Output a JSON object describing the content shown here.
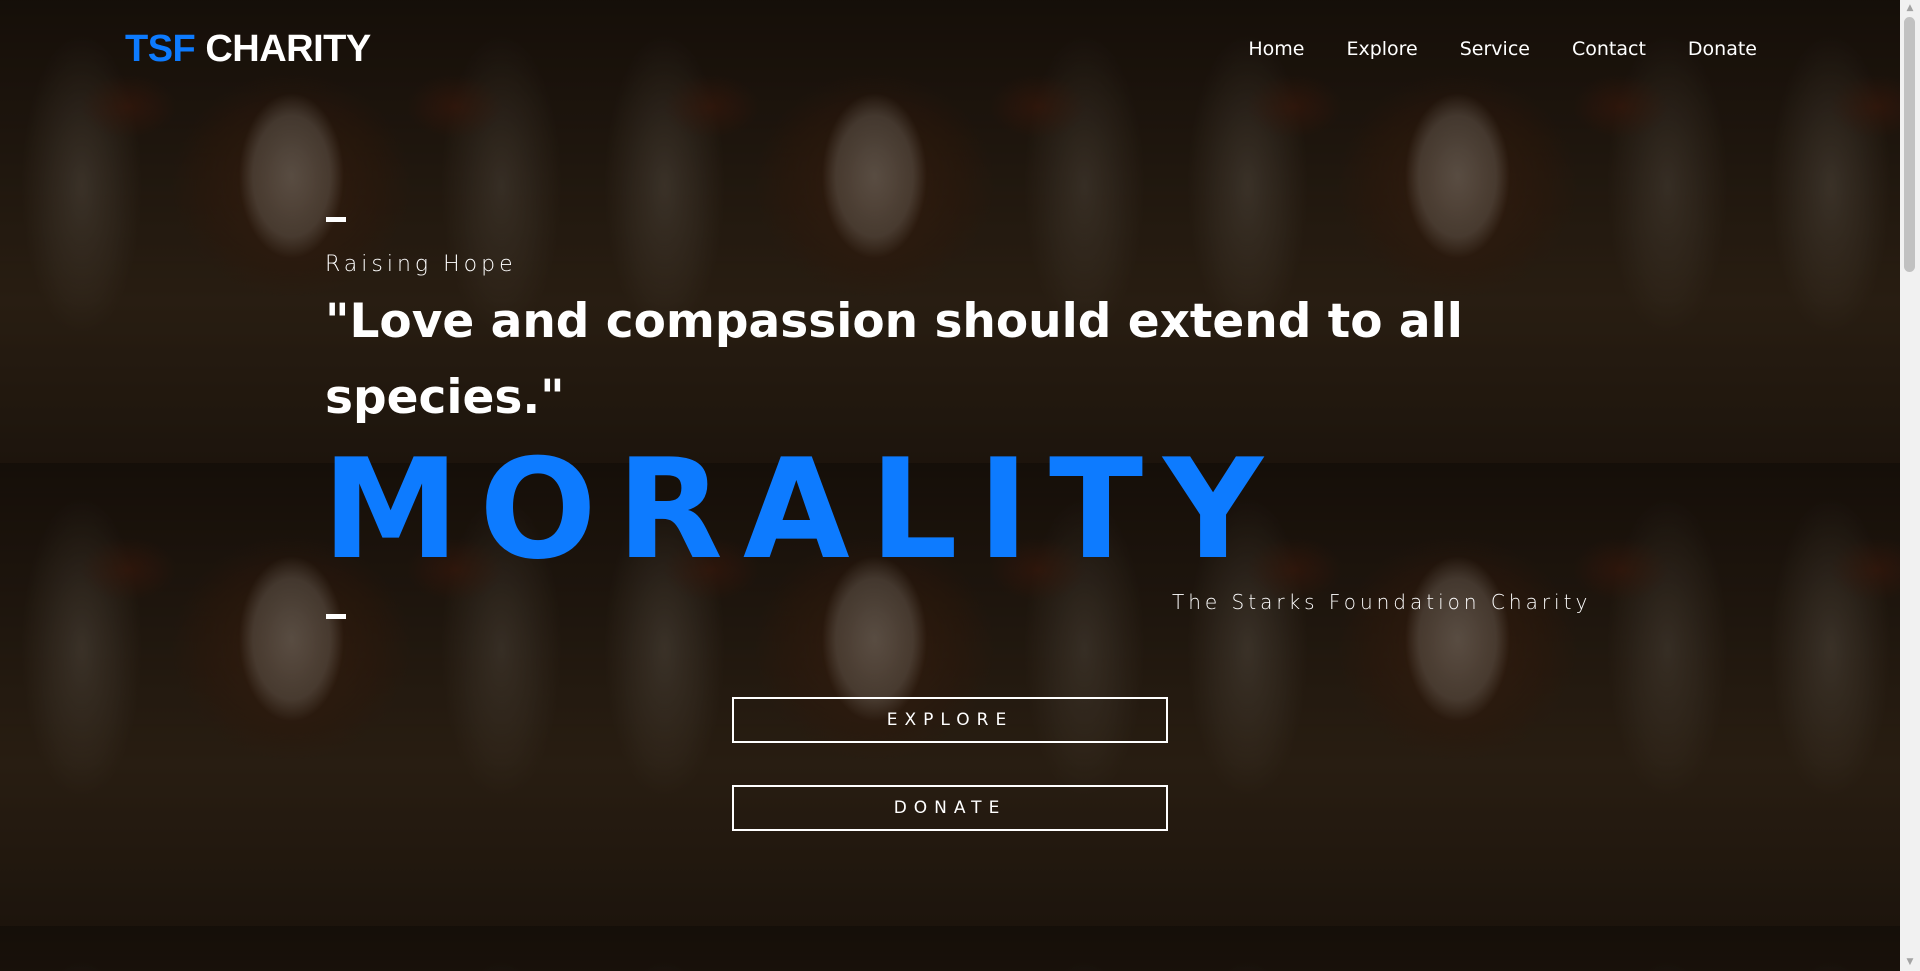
{
  "brand": {
    "accent_text": "TSF",
    "main_text": "CHARITY",
    "accent_color": "#0d7bff"
  },
  "nav": {
    "items": [
      {
        "label": "Home"
      },
      {
        "label": "Explore"
      },
      {
        "label": "Service"
      },
      {
        "label": "Contact"
      },
      {
        "label": "Donate"
      }
    ]
  },
  "hero": {
    "eyebrow": "Raising Hope",
    "quote": "\"Love and compassion should extend to all species.\"",
    "headline": "MORALITY",
    "organization": "The Starks Foundation Charity",
    "buttons": {
      "explore": "EXPLORE",
      "donate": "DONATE"
    }
  },
  "background": {
    "image": "calf-photo-tiled"
  }
}
